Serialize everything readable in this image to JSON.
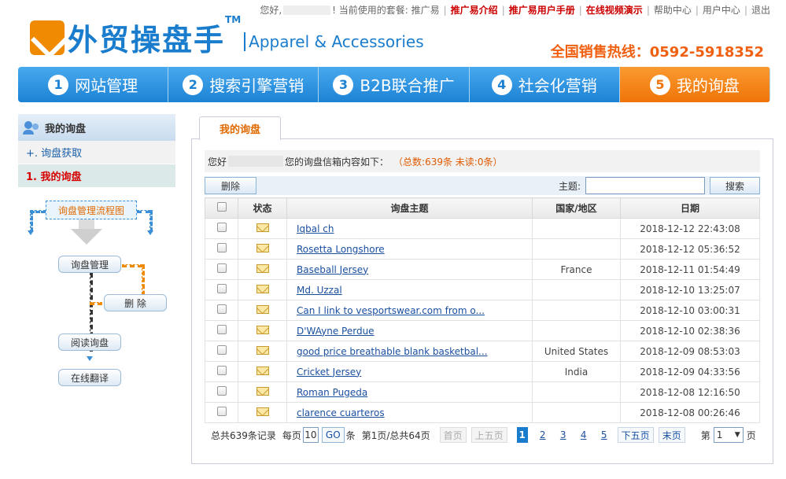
{
  "top_bar": {
    "greeting": "您好,",
    "package_text": "! 当前使用的套餐: 推广易",
    "links": [
      "推广易介绍",
      "推广易用户手册",
      "在线视频演示"
    ],
    "help_links": [
      "帮助中心",
      "用户中心",
      "退出"
    ]
  },
  "logo": {
    "cn": "外贸操盘手",
    "tm": "TM",
    "en": "Apparel & Accessories"
  },
  "hotline": "全国销售热线：0592-5918352",
  "steps": [
    {
      "num": "1",
      "label": "网站管理"
    },
    {
      "num": "2",
      "label": "搜索引擎营销"
    },
    {
      "num": "3",
      "label": "B2B联合推广"
    },
    {
      "num": "4",
      "label": "社会化营销"
    },
    {
      "num": "5",
      "label": "我的询盘"
    }
  ],
  "sidebar": {
    "title": "我的询盘",
    "items": [
      {
        "label": "+. 询盘获取"
      },
      {
        "label": "1. 我的询盘"
      }
    ],
    "flow": {
      "title": "询盘管理流程图",
      "manage": "询盘管理",
      "delete": "删 除",
      "read": "阅读询盘",
      "translate": "在线翻译"
    }
  },
  "tab_label": "我的询盘",
  "info": {
    "prefix": "您好",
    "suffix": "您的询盘信箱内容如下：",
    "counts": "（总数:639条  未读:0条）"
  },
  "toolbar": {
    "delete": "删除",
    "subject_label": "主题:",
    "search_value": "",
    "search": "搜索"
  },
  "table": {
    "headers": [
      "",
      "状态",
      "询盘主题",
      "国家/地区",
      "日期"
    ],
    "rows": [
      {
        "subject": "Iqbal ch",
        "country": "",
        "date": "2018-12-12 22:43:08"
      },
      {
        "subject": "Rosetta Longshore",
        "country": "",
        "date": "2018-12-12 05:36:52"
      },
      {
        "subject": "Baseball Jersey",
        "country": "France",
        "date": "2018-12-11 01:54:49"
      },
      {
        "subject": "Md. Uzzal",
        "country": "",
        "date": "2018-12-10 13:25:07"
      },
      {
        "subject": "Can I link to vesportswear.com from o...",
        "country": "",
        "date": "2018-12-10 03:00:31"
      },
      {
        "subject": "D'WAyne Perdue",
        "country": "",
        "date": "2018-12-10 02:38:36"
      },
      {
        "subject": "good price breathable blank basketbal...",
        "country": "United States",
        "date": "2018-12-09 08:53:03"
      },
      {
        "subject": "Cricket Jersey",
        "country": "India",
        "date": "2018-12-09 04:33:56"
      },
      {
        "subject": "Roman Pugeda",
        "country": "",
        "date": "2018-12-08 12:16:50"
      },
      {
        "subject": "clarence cuarteros",
        "country": "",
        "date": "2018-12-08 00:26:46"
      }
    ]
  },
  "pager": {
    "total": "总共639条记录",
    "per_label": "每页",
    "per_value": "10",
    "go": "GO",
    "per_unit": "条",
    "page_info": "第1页/总共64页",
    "first": "首页",
    "prev5": "上五页",
    "pages": [
      "1",
      "2",
      "3",
      "4",
      "5"
    ],
    "next5": "下五页",
    "last": "末页",
    "jump_prefix": "第",
    "jump_value": "1",
    "jump_suffix": "页"
  }
}
